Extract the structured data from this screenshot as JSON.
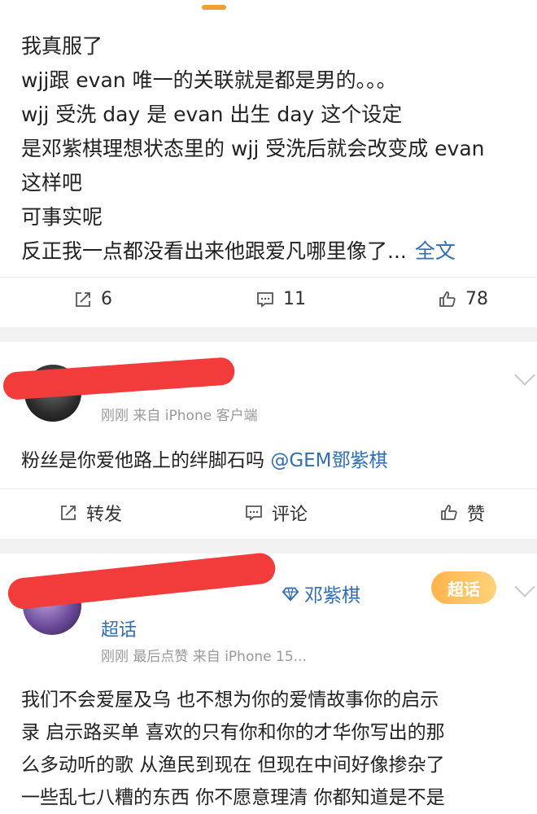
{
  "post": {
    "lines": [
      "我真服了",
      "wjj跟 evan 唯一的关联就是都是男的。。。",
      "wjj 受洗 day 是 evan 出生 day 这个设定",
      "是邓紫棋理想状态里的 wjj 受洗后就会改变成 evan",
      "这样吧",
      "可事实呢",
      "反正我一点都没看出来他跟爱凡哪里像了..."
    ],
    "more_label": "全文",
    "actions": {
      "repost": "6",
      "comment": "11",
      "like": "78"
    }
  },
  "comment1": {
    "meta": "刚刚  来自 iPhone 客户端",
    "text": "粉丝是你爱他路上的绊脚石吗 ",
    "mention": "@GEM鄧紫棋",
    "actions": {
      "repost": "转发",
      "comment": "评论",
      "like": "赞"
    }
  },
  "comment2": {
    "topic": "邓紫棋",
    "topic_suffix": "超话",
    "badge": "超话",
    "meta": "刚刚  最后点赞  来自 iPhone 15...",
    "lines": [
      "我们不会爱屋及乌 也不想为你的爱情故事你的启示",
      "录 启示路买单 喜欢的只有你和你的才华你写出的那",
      "么多动听的歌 从渔民到现在 但现在中间好像掺杂了",
      "一些乱七八糟的东西 你不愿意理清 你都知道是不是"
    ]
  },
  "colors": {
    "link": "#2f6fb8",
    "redaction": "#f23c3c",
    "badge": "#ffb44a"
  }
}
